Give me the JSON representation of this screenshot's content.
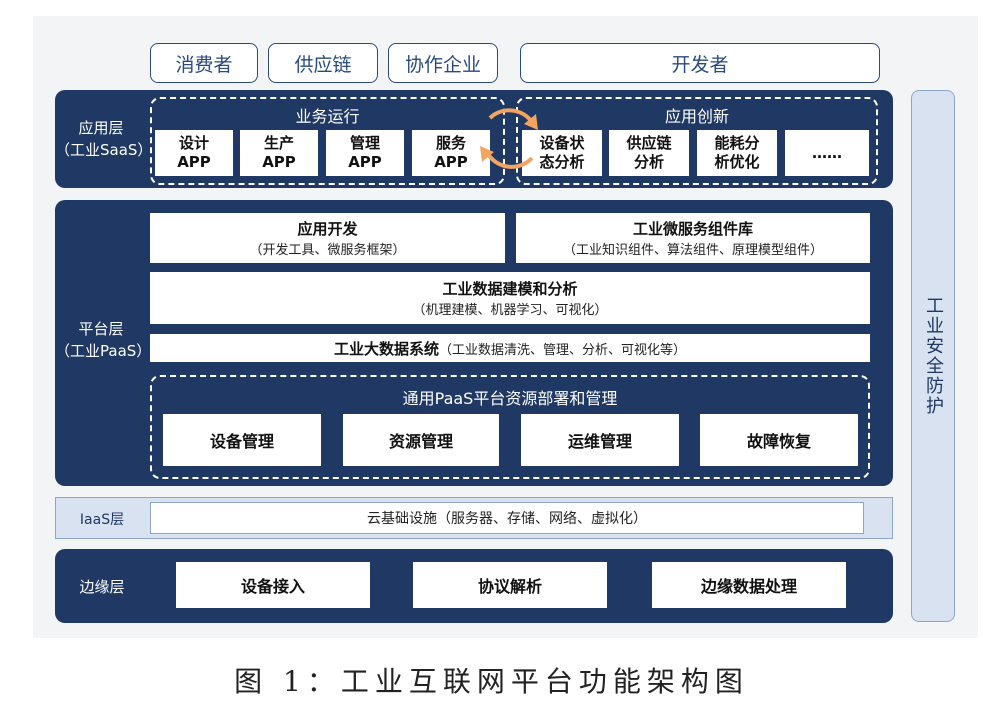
{
  "top_users": [
    "消费者",
    "供应链",
    "协作企业",
    "开发者"
  ],
  "app_layer": {
    "label_line1": "应用层",
    "label_line2": "（工业SaaS）",
    "business_group": {
      "title": "业务运行",
      "cards": [
        {
          "line1": "设计",
          "line2": "APP"
        },
        {
          "line1": "生产",
          "line2": "APP"
        },
        {
          "line1": "管理",
          "line2": "APP"
        },
        {
          "line1": "服务",
          "line2": "APP"
        }
      ]
    },
    "innovation_group": {
      "title": "应用创新",
      "cards": [
        {
          "line1": "设备状",
          "line2": "态分析"
        },
        {
          "line1": "供应链",
          "line2": "分析"
        },
        {
          "line1": "能耗分",
          "line2": "析优化"
        },
        {
          "line1": "……",
          "line2": ""
        }
      ]
    }
  },
  "platform_layer": {
    "label_line1": "平台层",
    "label_line2": "（工业PaaS）",
    "app_dev": {
      "title": "应用开发",
      "sub": "（开发工具、微服务框架）"
    },
    "microservice": {
      "title": "工业微服务组件库",
      "sub": "（工业知识组件、算法组件、原理模型组件）"
    },
    "modeling": {
      "title": "工业数据建模和分析",
      "sub": "（机理建模、机器学习、可视化）"
    },
    "bigdata": {
      "title": "工业大数据系统",
      "sub": "（工业数据清洗、管理、分析、可视化等）"
    },
    "paas_group": {
      "title": "通用PaaS平台资源部署和管理",
      "cards": [
        "设备管理",
        "资源管理",
        "运维管理",
        "故障恢复"
      ]
    }
  },
  "iaas_layer": {
    "label": "IaaS层",
    "content": "云基础设施（服务器、存储、网络、虚拟化）"
  },
  "edge_layer": {
    "label": "边缘层",
    "cards": [
      "设备接入",
      "协议解析",
      "边缘数据处理"
    ]
  },
  "security": "工业安全防护",
  "caption": "图 1：工业互联网平台功能架构图",
  "colors": {
    "navy": "#1f3864",
    "light_blue": "#d9e2f0",
    "arrow_orange": "#f4a460"
  }
}
